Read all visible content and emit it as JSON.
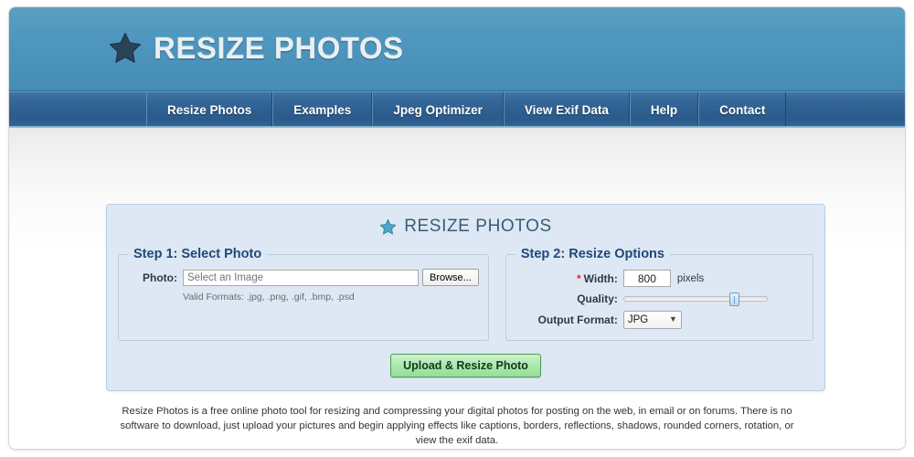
{
  "header": {
    "logo_text": "RESIZE PHOTOS",
    "logo_icon": "star-icon"
  },
  "nav": {
    "items": [
      {
        "label": "Resize Photos"
      },
      {
        "label": "Examples"
      },
      {
        "label": "Jpeg Optimizer"
      },
      {
        "label": "View Exif Data"
      },
      {
        "label": "Help"
      },
      {
        "label": "Contact"
      }
    ]
  },
  "panel": {
    "title": "RESIZE PHOTOS",
    "title_icon": "star-icon",
    "step1": {
      "legend": "Step 1: Select Photo",
      "photo_label": "Photo:",
      "photo_placeholder": "Select an Image",
      "photo_value": "",
      "browse_label": "Browse...",
      "formats_note": "Valid Formats: .jpg, .png, .gif, .bmp, .psd"
    },
    "step2": {
      "legend": "Step 2: Resize Options",
      "required_marker": "*",
      "width_label": "Width:",
      "width_value": "800",
      "width_unit": "pixels",
      "quality_label": "Quality:",
      "quality_percent": 79,
      "output_format_label": "Output Format:",
      "output_format_value": "JPG",
      "output_format_options": [
        "JPG"
      ],
      "select_arrow_icon": "chevron-down-icon"
    },
    "submit_label": "Upload & Resize Photo"
  },
  "footer": {
    "text": "Resize Photos is a free online photo tool for resizing and compressing your digital photos for posting on the web, in email or on forums. There is no software to download, just upload your pictures and begin applying effects like captions, borders, reflections, shadows, rounded corners, rotation, or view the exif data."
  },
  "colors": {
    "header_blue": "#4f97be",
    "nav_blue": "#2d5e8f",
    "panel_blue": "#dde8f4",
    "panel_border": "#b6cfe6",
    "legend_text": "#21487a",
    "submit_green": "#a9e6aa",
    "required_red": "#d62d2d",
    "panel_star_teal": "#49a8c8",
    "header_star_navy": "#2b4356"
  }
}
